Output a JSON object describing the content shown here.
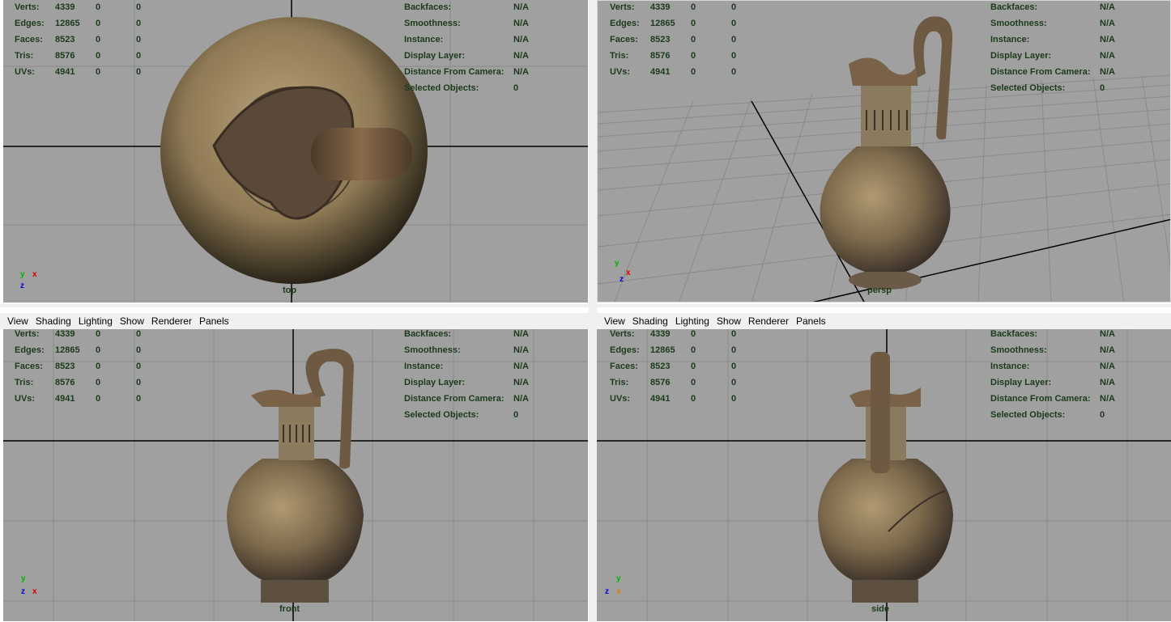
{
  "menu": [
    "View",
    "Shading",
    "Lighting",
    "Show",
    "Renderer",
    "Panels"
  ],
  "hud_left_labels": [
    "Verts:",
    "Edges:",
    "Faces:",
    "Tris:",
    "UVs:"
  ],
  "hud_left_values": [
    [
      "4339",
      "0",
      "0"
    ],
    [
      "12865",
      "0",
      "0"
    ],
    [
      "8523",
      "0",
      "0"
    ],
    [
      "8576",
      "0",
      "0"
    ],
    [
      "4941",
      "0",
      "0"
    ]
  ],
  "hud_right_labels": [
    "Backfaces:",
    "Smoothness:",
    "Instance:",
    "Display Layer:",
    "Distance From Camera:",
    "Selected Objects:"
  ],
  "hud_right_values": [
    "N/A",
    "N/A",
    "N/A",
    "N/A",
    "N/A",
    "0"
  ],
  "viewports": {
    "top": {
      "camera": "top",
      "axis": [
        "y",
        "x",
        "z"
      ]
    },
    "persp": {
      "camera": "persp",
      "axis": [
        "y",
        "x",
        "z"
      ]
    },
    "front": {
      "camera": "front",
      "axis": [
        "y",
        "z",
        "x"
      ]
    },
    "side": {
      "camera": "side",
      "axis": [
        "y",
        "z",
        "x"
      ]
    }
  },
  "colors": {
    "viewport_bg": "#a0a0a0",
    "hud_text": "#1c3a1c",
    "grid_line": "#8a8a8a",
    "axis_line": "#000000"
  }
}
